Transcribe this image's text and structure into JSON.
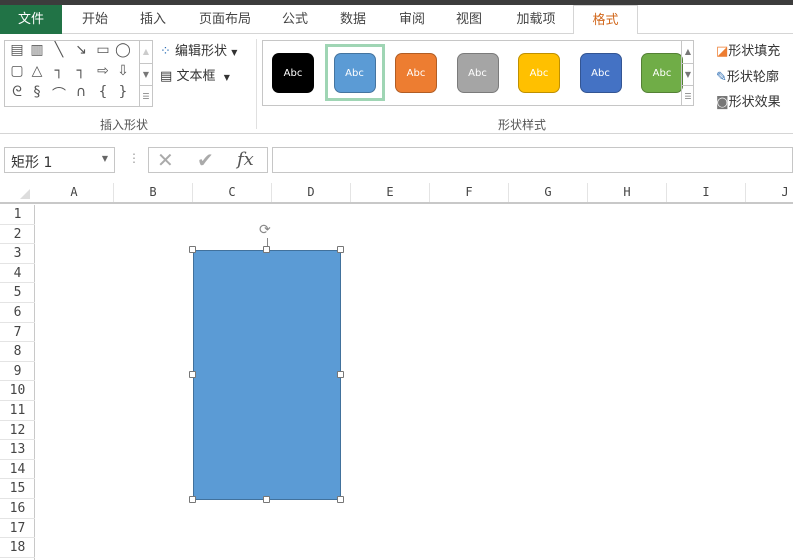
{
  "tabs": [
    {
      "label": "文件"
    },
    {
      "label": "开始"
    },
    {
      "label": "插入"
    },
    {
      "label": "页面布局"
    },
    {
      "label": "公式"
    },
    {
      "label": "数据"
    },
    {
      "label": "审阅"
    },
    {
      "label": "视图"
    },
    {
      "label": "加载项"
    },
    {
      "label": "格式"
    }
  ],
  "ribbon": {
    "insert_shapes": {
      "label": "插入形状",
      "edit_shape": "编辑形状",
      "text_box": "文本框"
    },
    "shape_styles": {
      "label": "形状样式",
      "swatch_text": "Abc",
      "swatches": [
        "#000000",
        "#5b9bd5",
        "#ed7d31",
        "#a5a5a5",
        "#ffc000",
        "#4472c4",
        "#70ad47"
      ],
      "selected_index": 1
    },
    "fill": "形状填充",
    "outline": "形状轮廓",
    "effects": "形状效果"
  },
  "formula_bar": {
    "name_box": "矩形 1",
    "fx": "fx",
    "value": ""
  },
  "columns": [
    "A",
    "B",
    "C",
    "D",
    "E",
    "F",
    "G",
    "H",
    "I",
    "J"
  ],
  "rows": [
    "1",
    "2",
    "3",
    "4",
    "5",
    "6",
    "7",
    "8",
    "9",
    "10",
    "11",
    "12",
    "13",
    "14",
    "15",
    "16",
    "17",
    "18"
  ],
  "shape": {
    "fill": "#5b9bd5"
  }
}
